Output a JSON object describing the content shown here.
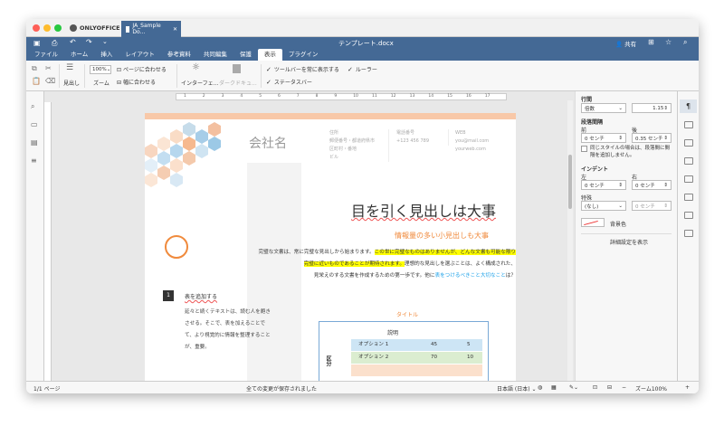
{
  "app": {
    "name": "ONLYOFFICE",
    "doc_tab": "JA_Sample Do...",
    "doc_title": "テンプレート.docx",
    "share": "共有"
  },
  "menu": [
    "ファイル",
    "ホーム",
    "挿入",
    "レイアウト",
    "参考資料",
    "共同編集",
    "保護",
    "表示",
    "プラグイン"
  ],
  "toolbar": {
    "navigation": "見出し",
    "zoom_value": "100%",
    "zoom_label": "ズーム",
    "fit_page": "ページに合わせる",
    "fit_width": "幅に合わせる",
    "interface_theme": "インターフェ...",
    "dark_doc": "ダークドキュ...",
    "always_toolbar": "ツールバーを常に表示する",
    "status_bar": "ステータスバー",
    "ruler": "ルーラー"
  },
  "ruler_marks": [
    "1",
    "2",
    "3",
    "4",
    "5",
    "6",
    "7",
    "8",
    "9",
    "10",
    "11",
    "12",
    "13",
    "14",
    "15",
    "16",
    "17"
  ],
  "document": {
    "company": "会社名",
    "col1_head": "住所",
    "col1_text": [
      "郵便番号・都道府県市",
      "区町村・番地",
      "ビル"
    ],
    "col2_head": "電話番号",
    "col2_text": "+123 456 789",
    "col3_head": "WEB",
    "col3_text": [
      "you@mail.com",
      "yourweb.com"
    ],
    "main_heading": "目を引く見出しは大事",
    "sub_heading": "情報量の多い小見出しも大事",
    "para1_a": "完璧な文書は、常に完璧な見出しから始まります。",
    "para1_hl": "この世に完璧なものはありませんが、どんな文書も可能な限り",
    "para2_hl": "完璧に近いものであることが期待されます。",
    "para2_b": "理想的な見出しを選ぶことは、よく構成された、",
    "para3_a": "見栄えのする文書を作成するための第一歩です。他に",
    "para3_link": "表をつけるべきこと大切なこと",
    "para3_b": "は？",
    "side_num": "1",
    "side_title": "表を追加する",
    "side_lines": [
      "延々と続くテキストは、読む人を飽き",
      "させる。そこで、表を加えることで",
      "て、より視覚的に情報を整理すること",
      "が、重要。"
    ],
    "table_title": "タイトル",
    "table_head": "説明",
    "table_rows": [
      {
        "label": "オプション 1",
        "a": "45",
        "b": "5"
      },
      {
        "label": "オプション 2",
        "a": "70",
        "b": "10"
      }
    ],
    "table_vertical": "区分"
  },
  "panel": {
    "line_spacing": "行間",
    "line_mode": "倍数",
    "line_value": "1.15",
    "para_spacing": "段落間隔",
    "before": "前",
    "after": "後",
    "before_value": "0 センチ",
    "after_value": "0.35 センチ",
    "same_style": "同じスタイルの場合は、段落間に間隔を追加しません。",
    "indent": "インデント",
    "left": "左",
    "right": "右",
    "left_value": "0 センチ",
    "right_value": "0 センチ",
    "special": "特殊",
    "special_value": "(なし)",
    "special_amount": "0 センチ",
    "bg_color": "背景色",
    "advanced": "詳細設定を表示"
  },
  "status": {
    "page": "1/1 ページ",
    "saved": "全ての変更が保存されました",
    "language": "日本語 (日本)",
    "zoom": "ズーム100%"
  },
  "colors": {
    "brand": "#446995",
    "accent": "#f39c5a",
    "highlight": "#ffff00",
    "link": "#1aa0e8"
  }
}
